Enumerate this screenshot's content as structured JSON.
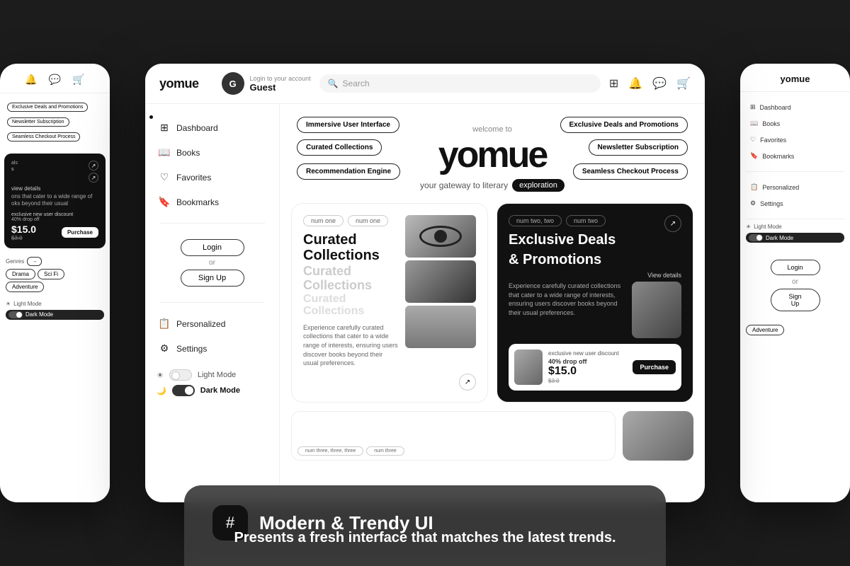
{
  "app": {
    "name": "yomue",
    "tagline_welcome": "welcome to",
    "tagline_sub": "your gateway to literary",
    "tagline_highlight": "exploration"
  },
  "header": {
    "logo": "yomue",
    "login_label": "Login to your account",
    "user_name": "Guest",
    "avatar_letter": "G",
    "search_placeholder": "Search",
    "filter_icon": "⊞",
    "bell_icon": "🔔",
    "chat_icon": "💬",
    "cart_icon": "🛒"
  },
  "sidebar": {
    "items": [
      {
        "label": "Dashboard",
        "icon": "⊞",
        "active": true
      },
      {
        "label": "Books",
        "icon": "📖"
      },
      {
        "label": "Favorites",
        "icon": "♡"
      },
      {
        "label": "Bookmarks",
        "icon": "🔖"
      }
    ],
    "bottom_items": [
      {
        "label": "Personalized",
        "icon": "📋"
      },
      {
        "label": "Settings",
        "icon": "⚙"
      }
    ]
  },
  "feature_badges": [
    {
      "label": "Immersive User Interface",
      "position": "top-left"
    },
    {
      "label": "Exclusive Deals and Promotions",
      "position": "top-right"
    },
    {
      "label": "Curated Collections",
      "position": "mid-left"
    },
    {
      "label": "Newsletter Subscription",
      "position": "mid-right"
    },
    {
      "label": "Recommendation Engine",
      "position": "bottom-left"
    },
    {
      "label": "Seamless Checkout Process",
      "position": "bottom-right"
    }
  ],
  "cards": {
    "card1": {
      "tags": [
        "num one",
        "num one"
      ],
      "title_main": "Curated Collections",
      "title_secondary": "Curated Collections",
      "title_tertiary": "Curated Collections",
      "description": "Experience carefully curated collections that cater to a wide range of interests, ensuring users discover books beyond their usual preferences."
    },
    "card2": {
      "tags": [
        "num two, two",
        "num two"
      ],
      "title_main": "Exclusive Deals",
      "title_main2": "& Promotions",
      "view_details": "View details",
      "description": "Experience carefully curated collections that cater to a wide range of interests, ensuring users discover books beyond their usual preferences.",
      "product": {
        "discount_label": "exclusive new user discount",
        "percent": "40% drop off",
        "price": "$15.0",
        "old_price": "$3.0",
        "purchase_btn": "Purchase"
      }
    }
  },
  "login_section": {
    "login_btn": "Login",
    "or": "or",
    "signup_btn": "Sign Up"
  },
  "modes": [
    {
      "label": "Light Mode",
      "active": false
    },
    {
      "label": "Dark Mode",
      "active": true
    }
  ],
  "bottom_overlay": {
    "icon": "#",
    "title": "Modern & Trendy UI",
    "subtitle": "Presents a fresh interface that matches the latest trends."
  },
  "phone": {
    "logo": "yomue",
    "badges": [
      "Exclusive Deals and Promotions",
      "Newsletter Subscription",
      "Seamless Checkout Process"
    ],
    "card_title": "Exclusive Deals & Promotions",
    "discount": "exclusive new user discount",
    "percent": "40% drop off",
    "price": "$15.0",
    "old_price": "$3.0",
    "purchase_btn": "Purchase",
    "genres": [
      "Drama",
      "Sci Fi",
      "Adventure"
    ],
    "genres_label": "Genres"
  }
}
